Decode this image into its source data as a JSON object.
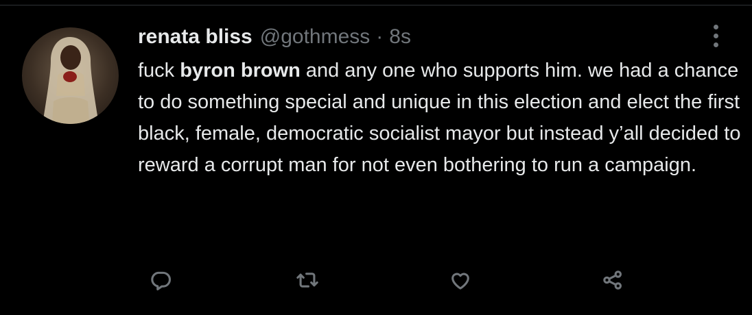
{
  "tweet": {
    "author": {
      "display_name": "renata bliss",
      "handle": "@gothmess",
      "avatar_icon": "user-avatar-photo"
    },
    "separator": "·",
    "timestamp": "8s",
    "text": {
      "part1": "fuck ",
      "bold": "byron brown",
      "part2": " and any one who supports him. we had a chance to do something special and unique in this election and elect the first black, female, democratic socialist mayor but instead y’all decided to reward a corrupt man for not even bothering to run a campaign."
    }
  },
  "actions": {
    "reply_icon": "reply-icon",
    "retweet_icon": "retweet-icon",
    "like_icon": "heart-icon",
    "share_icon": "share-icon"
  },
  "colors": {
    "background": "#000000",
    "text": "#e7e9ea",
    "muted": "#71767b",
    "divider": "#2f3336"
  }
}
